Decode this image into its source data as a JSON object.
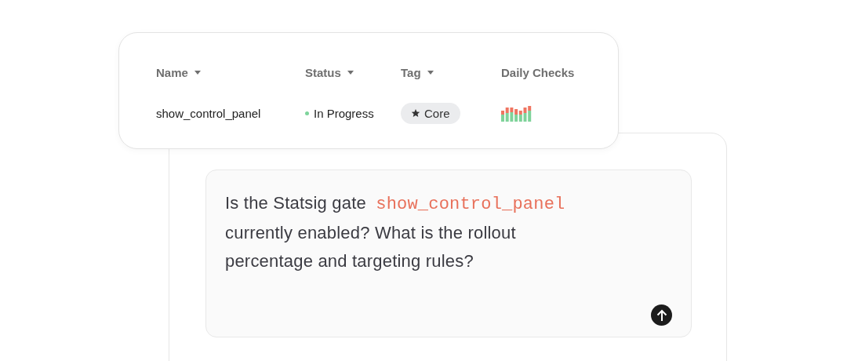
{
  "table": {
    "columns": [
      {
        "label": "Name",
        "dropdown": true
      },
      {
        "label": "Status",
        "dropdown": true
      },
      {
        "label": "Tag",
        "dropdown": true
      },
      {
        "label": "Daily Checks",
        "dropdown": false
      }
    ],
    "rows": [
      {
        "name": "show_control_panel",
        "status": "In Progress",
        "color": "#7ed49b",
        "tag": "Core"
      }
    ]
  },
  "prompt": {
    "parts": [
      {
        "kind": "text",
        "text": "Is the Statsig gate"
      },
      {
        "kind": "code",
        "text": "show_control_panel"
      },
      {
        "kind": "text",
        "text": "currently enabled? What is the rollout percentage and targeting rules?"
      }
    ]
  }
}
